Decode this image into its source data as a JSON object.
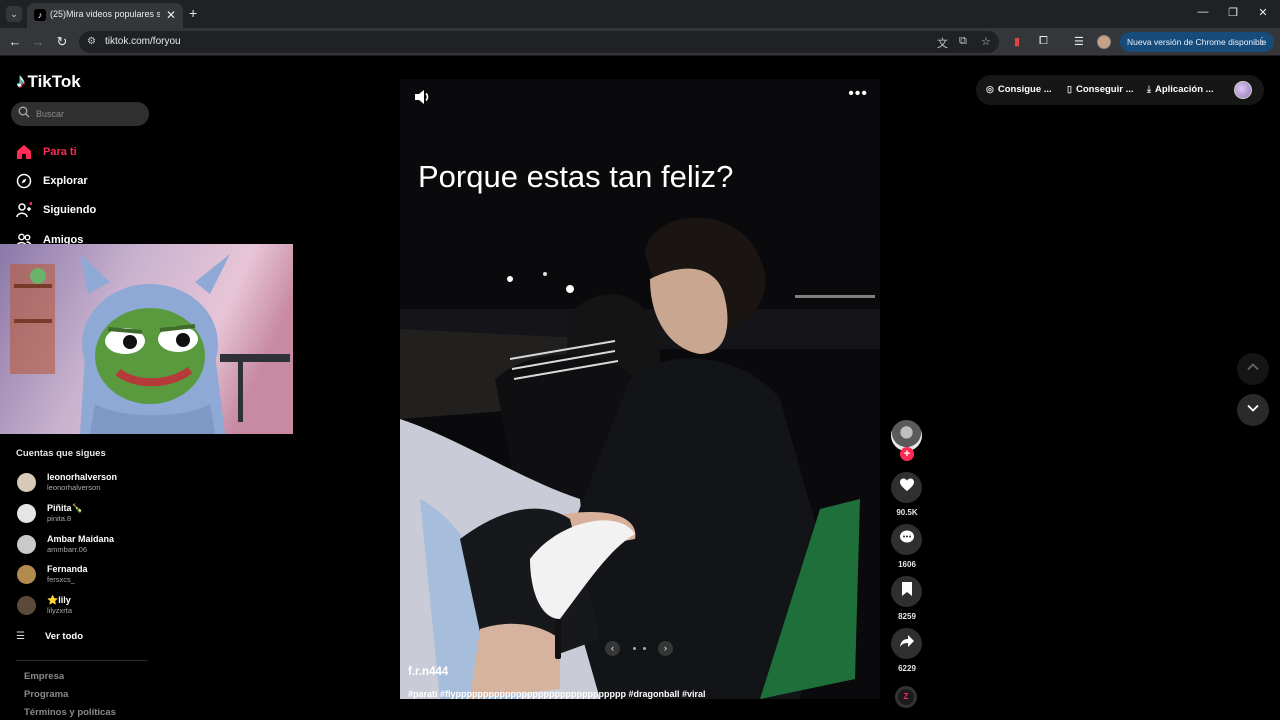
{
  "browser": {
    "tab_title": "(25)Mira videos populares selec",
    "new_tab": "+",
    "tab_close": "✕",
    "url": "tiktok.com/foryou",
    "update_button": "Nueva versión de Chrome disponible",
    "window_controls": {
      "minimize": "—",
      "restore": "❐",
      "close": "✕"
    }
  },
  "app": {
    "logo_text": "TikTok",
    "search_placeholder": "Buscar",
    "nav": [
      {
        "label": "Para ti",
        "icon": "home-icon",
        "active": true
      },
      {
        "label": "Explorar",
        "icon": "compass-icon",
        "active": false
      },
      {
        "label": "Siguiendo",
        "icon": "user-follow-icon",
        "active": false
      },
      {
        "label": "Amigos",
        "icon": "friends-icon",
        "active": false
      }
    ],
    "following_title": "Cuentas que sigues",
    "accounts": [
      {
        "name": "leonorhalverson",
        "handle": "leonorhalverson",
        "color": "#d9c9b8"
      },
      {
        "name": "Piñita🍾",
        "handle": "pinita.8",
        "color": "#e5e5e5"
      },
      {
        "name": "Ambar Maidana",
        "handle": "ammbarr.06",
        "color": "#c9c9c9"
      },
      {
        "name": "Fernanda",
        "handle": "fersxcs_",
        "color": "#b38a4d"
      },
      {
        "name": "⭐lily",
        "handle": "lilyzxrta",
        "color": "#5b4a3a"
      }
    ],
    "see_all": "Ver todo",
    "footer": [
      "Empresa",
      "Programa",
      "Términos y políticas"
    ]
  },
  "video": {
    "caption": "Porque estas tan feliz?",
    "author": "f.r.n444",
    "hashtags": "#parati #flyppppppppppppppppppppppppppppppp #dragonball #viral",
    "likes": "90.5K",
    "comments": "1606",
    "saves": "8259",
    "shares": "6229",
    "follow_symbol": "+",
    "music_label": "Z"
  },
  "header_pills": [
    {
      "label": "Consigue ...",
      "icon": "coin-icon"
    },
    {
      "label": "Conseguir ...",
      "icon": "phone-icon"
    },
    {
      "label": "Aplicación ...",
      "icon": "download-icon"
    }
  ],
  "colors": {
    "accent": "#fe2c55",
    "background": "#000000",
    "chrome_bar": "#35363a",
    "update_pill": "#174c7a"
  }
}
